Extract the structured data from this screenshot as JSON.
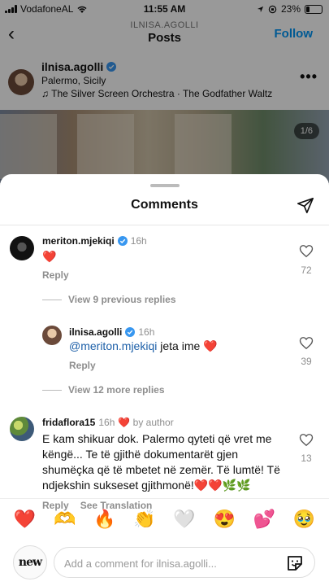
{
  "status_bar": {
    "carrier": "VodafoneAL",
    "time": "11:55 AM",
    "battery": "23%",
    "battery_level": 0.23
  },
  "nav": {
    "username": "ILNISA.AGOLLI",
    "title": "Posts",
    "follow_label": "Follow",
    "back_icon": "chevron-left-icon"
  },
  "post": {
    "author": "ilnisa.agolli",
    "location": "Palermo, Sicily",
    "music": "The Silver Screen Orchestra · The Godfather Waltz",
    "image_counter": "1/6",
    "more_icon": "more-horizontal-icon"
  },
  "sheet": {
    "title": "Comments",
    "share_icon": "send-icon"
  },
  "comments": [
    {
      "user": "meriton.mjekiqi",
      "verified": true,
      "time": "16h",
      "text": "❤️",
      "reply_label": "Reply",
      "likes": "72"
    },
    {
      "view_replies": "View 9 previous replies"
    },
    {
      "user": "ilnisa.agolli",
      "verified": true,
      "time": "16h",
      "mention": "@meriton.mjekiqi",
      "text": " jeta ime ❤️",
      "reply_label": "Reply",
      "likes": "39"
    },
    {
      "view_replies": "View 12 more replies"
    },
    {
      "user": "fridaflora15",
      "time": "16h",
      "author_like": "❤️ by author",
      "text": "E kam shikuar dok. Palermo qyteti që vret me këngë... Te të gjithë dokumentarët gjen shumëçka që të mbetet në zemër. Të lumtë! Të ndjekshin sukseset gjithmonë!❤️❤️🌿🌿",
      "reply_label": "Reply",
      "translation_label": "See Translation",
      "likes": "13"
    }
  ],
  "emoji_bar": [
    "❤️",
    "🫶",
    "🔥",
    "👏",
    "🤍",
    "😍",
    "💕",
    "🥹"
  ],
  "composer": {
    "avatar_text": "new",
    "placeholder": "Add a comment for ilnisa.agolli...",
    "sticker_icon": "sticker-icon"
  },
  "colors": {
    "accent": "#0095f6",
    "mention": "#1c5fa8",
    "heart": "#e0245e",
    "verified": "#3897f0"
  }
}
